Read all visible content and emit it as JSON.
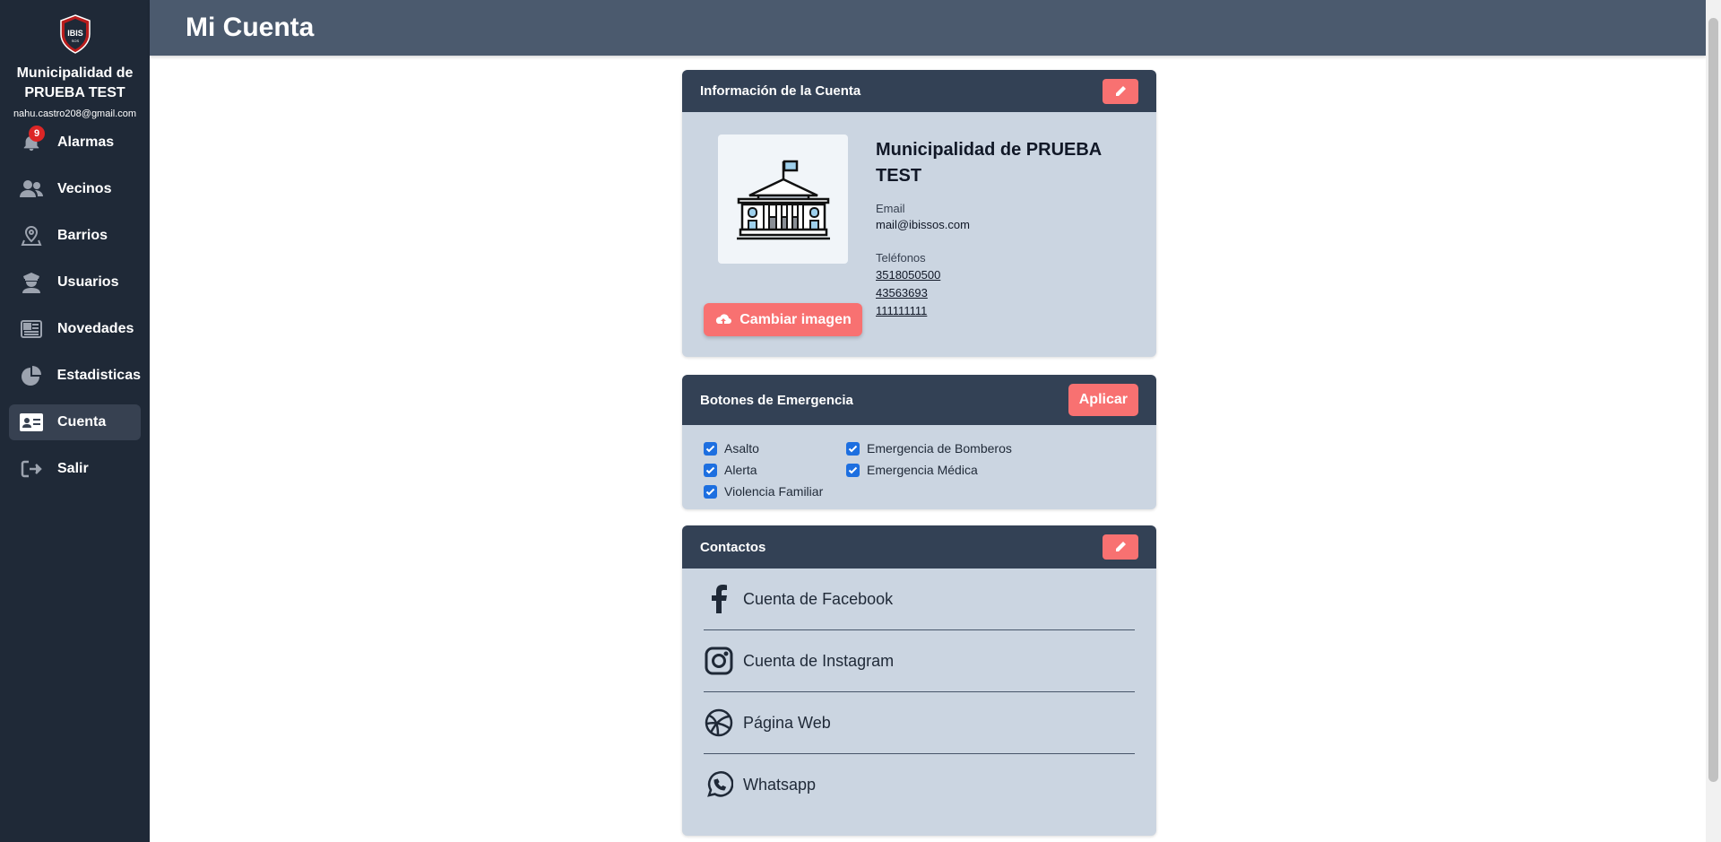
{
  "sidebar": {
    "logo_text": "IBIS",
    "logo_sub": "SOS",
    "org_name": "Municipalidad de PRUEBA TEST",
    "email": "nahu.castro208@gmail.com",
    "items": [
      {
        "label": "Alarmas",
        "icon": "bell-icon",
        "badge": "9"
      },
      {
        "label": "Vecinos",
        "icon": "users-icon"
      },
      {
        "label": "Barrios",
        "icon": "map-pin-icon"
      },
      {
        "label": "Usuarios",
        "icon": "officer-icon"
      },
      {
        "label": "Novedades",
        "icon": "newspaper-icon"
      },
      {
        "label": "Estadisticas",
        "icon": "pie-chart-icon"
      },
      {
        "label": "Cuenta",
        "icon": "id-card-icon",
        "active": true
      },
      {
        "label": "Salir",
        "icon": "logout-icon"
      }
    ]
  },
  "header": {
    "title": "Mi Cuenta"
  },
  "account": {
    "title": "Información de la Cuenta",
    "name": "Municipalidad de PRUEBA TEST",
    "email_label": "Email",
    "email": "mail@ibissos.com",
    "phones_label": "Teléfonos",
    "phones": [
      "3518050500",
      "43563693",
      "111111111"
    ],
    "change_image_label": "Cambiar imagen"
  },
  "emergency": {
    "title": "Botones de Emergencia",
    "apply_label": "Aplicar",
    "options": [
      {
        "label": "Asalto",
        "checked": true
      },
      {
        "label": "Emergencia de Bomberos",
        "checked": true
      },
      {
        "label": "Alerta",
        "checked": true
      },
      {
        "label": "Emergencia Médica",
        "checked": true
      },
      {
        "label": "Violencia Familiar",
        "checked": true
      }
    ]
  },
  "contacts": {
    "title": "Contactos",
    "items": [
      {
        "label": "Cuenta de Facebook",
        "icon": "facebook-icon"
      },
      {
        "label": "Cuenta de Instagram",
        "icon": "instagram-icon"
      },
      {
        "label": "Página Web",
        "icon": "web-icon"
      },
      {
        "label": "Whatsapp",
        "icon": "whatsapp-icon"
      }
    ]
  },
  "colors": {
    "sidebar_bg": "#1f2937",
    "header_bg": "#4b5a6e",
    "card_bg": "#cbd5e1",
    "card_header_bg": "#334155",
    "accent": "#f87171",
    "checkbox": "#1d6fe0"
  }
}
